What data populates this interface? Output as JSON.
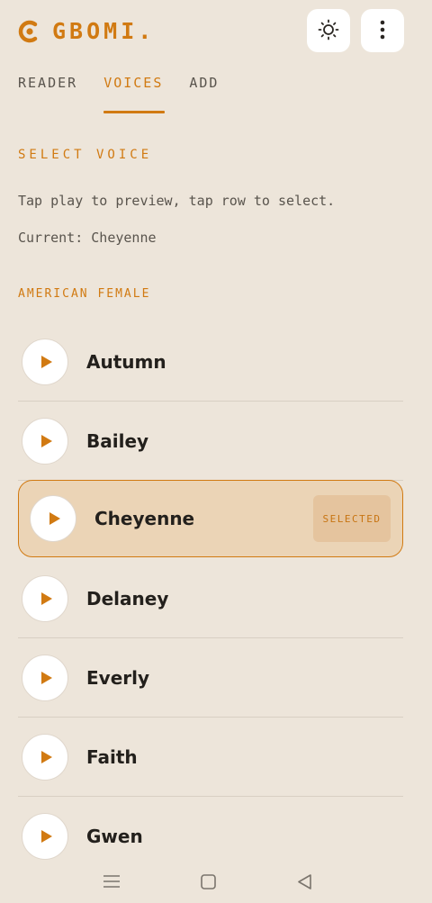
{
  "app": {
    "name": "GBOMI.",
    "accent": "#d17a12"
  },
  "header": {
    "theme_icon": "sun-icon",
    "menu_icon": "more-vertical-icon"
  },
  "tabs": [
    {
      "label": "READER",
      "active": false
    },
    {
      "label": "VOICES",
      "active": true
    },
    {
      "label": "ADD",
      "active": false
    }
  ],
  "voices_page": {
    "section_title": "SELECT VOICE",
    "help_text": "Tap play to preview, tap row to select.",
    "current_text": "Current: Cheyenne",
    "group_title": "AMERICAN FEMALE",
    "selected_badge": "SELECTED",
    "voices": [
      {
        "name": "Autumn",
        "selected": false
      },
      {
        "name": "Bailey",
        "selected": false
      },
      {
        "name": "Cheyenne",
        "selected": true
      },
      {
        "name": "Delaney",
        "selected": false
      },
      {
        "name": "Everly",
        "selected": false
      },
      {
        "name": "Faith",
        "selected": false
      },
      {
        "name": "Gwen",
        "selected": false
      }
    ]
  },
  "system_nav": {
    "items": [
      "menu-icon",
      "home-icon",
      "back-icon"
    ]
  }
}
